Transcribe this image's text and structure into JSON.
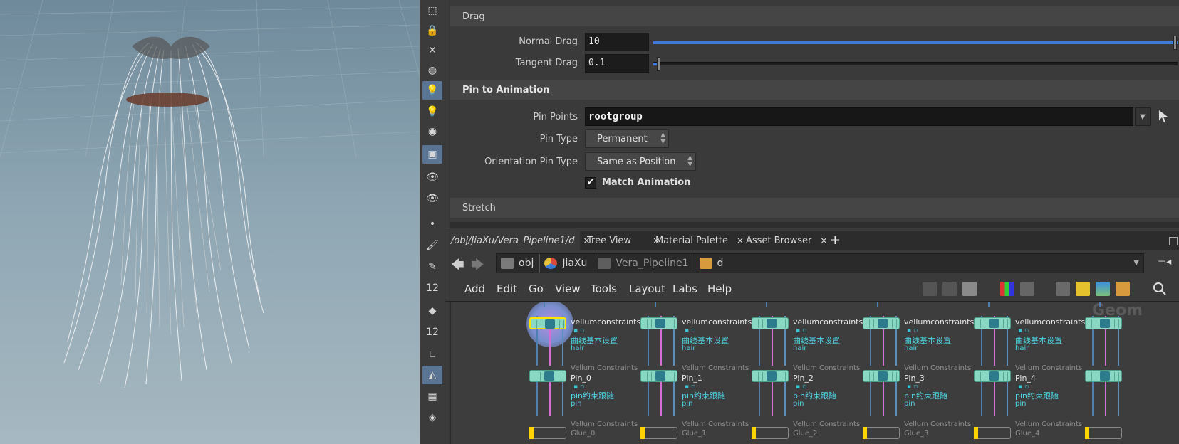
{
  "viewport": {
    "label": ""
  },
  "vtoolbar": {
    "tools": [
      {
        "name": "select-icon",
        "glyph": "⬚"
      },
      {
        "name": "lock-icon",
        "glyph": "🔒"
      },
      {
        "name": "ghost-icon",
        "glyph": "✕"
      },
      {
        "name": "shading-icon",
        "glyph": "◍"
      },
      {
        "name": "light-icon",
        "glyph": "💡"
      },
      {
        "name": "headlight-icon",
        "glyph": "💡"
      },
      {
        "name": "light-settings-icon",
        "glyph": "◉"
      },
      {
        "name": "display-options-icon",
        "glyph": "▣"
      },
      {
        "name": "camera-view-icon",
        "glyph": "👁"
      },
      {
        "name": "camera-settings-icon",
        "glyph": "👁"
      },
      {
        "name": "point-icon",
        "glyph": "•"
      },
      {
        "name": "brush-icon",
        "glyph": "🖌"
      },
      {
        "name": "dropper-icon",
        "glyph": "✎"
      },
      {
        "name": "point-numbers-icon",
        "glyph": "12"
      },
      {
        "name": "prim-icon",
        "glyph": "◆"
      },
      {
        "name": "prim-numbers-icon",
        "glyph": "12"
      },
      {
        "name": "normals-icon",
        "glyph": "∟"
      },
      {
        "name": "template-icon",
        "glyph": "◭"
      },
      {
        "name": "texture-icon",
        "glyph": "▦"
      },
      {
        "name": "snapshot-icon",
        "glyph": "◈"
      }
    ]
  },
  "params": {
    "drag_section": "Drag",
    "normal_drag": {
      "label": "Normal Drag",
      "value": "10",
      "slider_fraction": 1.0
    },
    "tangent_drag": {
      "label": "Tangent Drag",
      "value": "0.1",
      "slider_fraction": 0.01
    },
    "pin_section": "Pin to Animation",
    "pin_points": {
      "label": "Pin Points",
      "value": "rootgroup"
    },
    "pin_type": {
      "label": "Pin Type",
      "value": "Permanent"
    },
    "orientation_pin_type": {
      "label": "Orientation Pin Type",
      "value": "Same as Position"
    },
    "match_animation": {
      "label": "Match Animation",
      "checked": true,
      "check_glyph": "✔"
    },
    "stretch_section": "Stretch"
  },
  "tabs": {
    "items": [
      {
        "label": "/obj/JiaXu/Vera_Pipeline1/d"
      },
      {
        "label": "Tree View"
      },
      {
        "label": "Material Palette"
      },
      {
        "label": "Asset Browser"
      }
    ],
    "close_glyph": "×",
    "add_glyph": "+"
  },
  "pathbar": {
    "crumbs": [
      {
        "label": "obj",
        "color": "#888888"
      },
      {
        "label": "JiaXu",
        "color": "#d94a3a"
      },
      {
        "label": "Vera_Pipeline1",
        "color": "#777777"
      },
      {
        "label": "d",
        "color": "#d79a3c"
      }
    ]
  },
  "netmenu": {
    "items": [
      "Add",
      "Edit",
      "Go",
      "View",
      "Tools",
      "Layout",
      "Labs",
      "Help"
    ]
  },
  "network": {
    "watermark": "Geom",
    "top_nodes": [
      {
        "name": "vellumconstraints1",
        "comment": "曲线基本设置",
        "group": "hair"
      },
      {
        "name": "vellumconstraints2",
        "comment": "曲线基本设置",
        "group": "hair"
      },
      {
        "name": "vellumconstraints3",
        "comment": "曲线基本设置",
        "group": "hair"
      },
      {
        "name": "vellumconstraints4",
        "comment": "曲线基本设置",
        "group": "hair"
      },
      {
        "name": "vellumconstraints5",
        "comment": "曲线基本设置",
        "group": "hair"
      }
    ],
    "pin_nodes": [
      {
        "type": "Vellum Constraints",
        "name": "Pin_0",
        "comment": "pin约束跟随",
        "group": "pin"
      },
      {
        "type": "Vellum Constraints",
        "name": "Pin_1",
        "comment": "pin约束跟随",
        "group": "pin"
      },
      {
        "type": "Vellum Constraints",
        "name": "Pin_2",
        "comment": "pin约束跟随",
        "group": "pin"
      },
      {
        "type": "Vellum Constraints",
        "name": "Pin_3",
        "comment": "pin约束跟随",
        "group": "pin"
      },
      {
        "type": "Vellum Constraints",
        "name": "Pin_4",
        "comment": "pin约束跟随",
        "group": "pin"
      }
    ],
    "glue_nodes": [
      {
        "type": "Vellum Constraints",
        "name": "Glue_0"
      },
      {
        "type": "Vellum Constraints",
        "name": "Glue_1"
      },
      {
        "type": "Vellum Constraints",
        "name": "Glue_2"
      },
      {
        "type": "Vellum Constraints",
        "name": "Glue_3"
      },
      {
        "type": "Vellum Constraints",
        "name": "Glue_4"
      }
    ]
  }
}
